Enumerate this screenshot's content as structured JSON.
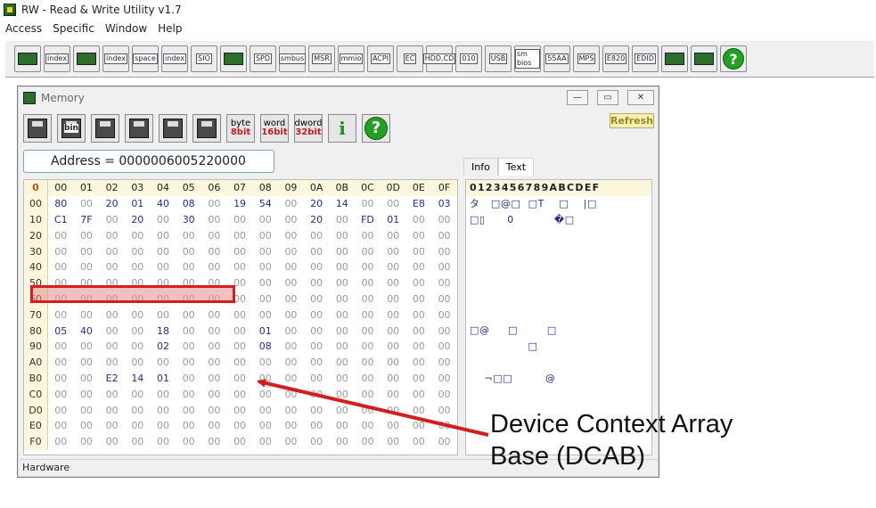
{
  "window_title": "RW - Read & Write Utility v1.7",
  "menu": [
    "Access",
    "Specific",
    "Window",
    "Help"
  ],
  "toolbar": [
    {
      "icon": "pci-chip-icon",
      "label": ""
    },
    {
      "icon": "pci-index-icon",
      "label": "index"
    },
    {
      "icon": "memory-icon",
      "label": ""
    },
    {
      "icon": "memory-index-icon",
      "label": "index"
    },
    {
      "icon": "io-space-icon",
      "label": "space"
    },
    {
      "icon": "io-index-icon",
      "label": "index"
    },
    {
      "icon": "sio-icon",
      "label": "SIO"
    },
    {
      "icon": "oscilloscope-icon",
      "label": ""
    },
    {
      "icon": "spd-icon",
      "label": "SPD"
    },
    {
      "icon": "smbus-icon",
      "label": "smbus"
    },
    {
      "icon": "msr-icon",
      "label": "MSR"
    },
    {
      "icon": "mmio-icon",
      "label": "mmio"
    },
    {
      "icon": "acpi-icon",
      "label": "ACPI"
    },
    {
      "icon": "ec-icon",
      "label": "EC"
    },
    {
      "icon": "hdd-cd-icon",
      "label": "HDD,CD"
    },
    {
      "icon": "binary-icon",
      "label": "010"
    },
    {
      "icon": "usb-icon",
      "label": "USB"
    },
    {
      "icon": "smbios-icon",
      "label": "sm bios"
    },
    {
      "icon": "55aa-icon",
      "label": "55AA"
    },
    {
      "icon": "mps-icon",
      "label": "MPS"
    },
    {
      "icon": "e820-icon",
      "label": "E820"
    },
    {
      "icon": "edid-icon",
      "label": "EDID"
    },
    {
      "icon": "console-icon",
      "label": ""
    },
    {
      "icon": "tools-icon",
      "label": ""
    },
    {
      "icon": "help-icon",
      "label": "?"
    }
  ],
  "mem_window": {
    "title": "Memory",
    "refresh_label": "Refresh",
    "address": "Address = 0000006005220000",
    "tools": [
      {
        "icon": "save-icon",
        "l1": "",
        "l2": ""
      },
      {
        "icon": "save-bin-icon",
        "l1": "bin",
        "l2": ""
      },
      {
        "icon": "open-icon",
        "l1": "",
        "l2": ""
      },
      {
        "icon": "open-compare-icon",
        "l1": "",
        "l2": ""
      },
      {
        "icon": "binoculars-icon",
        "l1": "",
        "l2": ""
      },
      {
        "icon": "window-icon",
        "l1": "",
        "l2": ""
      },
      {
        "icon": "byte-mode-icon",
        "l1": "byte",
        "l2": "8bit"
      },
      {
        "icon": "word-mode-icon",
        "l1": "word",
        "l2": "16bit"
      },
      {
        "icon": "dword-mode-icon",
        "l1": "dword",
        "l2": "32bit"
      },
      {
        "icon": "info-icon",
        "l1": "i",
        "l2": ""
      },
      {
        "icon": "help-icon",
        "l1": "?",
        "l2": ""
      }
    ],
    "tabs": [
      "Info",
      "Text"
    ],
    "status": "Hardware"
  },
  "hex": {
    "corner": "0",
    "columns": [
      "00",
      "01",
      "02",
      "03",
      "04",
      "05",
      "06",
      "07",
      "08",
      "09",
      "0A",
      "0B",
      "0C",
      "0D",
      "0E",
      "0F"
    ],
    "rows": [
      {
        "label": "00",
        "cells": [
          "80",
          "00",
          "20",
          "01",
          "40",
          "08",
          "00",
          "19",
          "54",
          "00",
          "20",
          "14",
          "00",
          "00",
          "E8",
          "03"
        ]
      },
      {
        "label": "10",
        "cells": [
          "C1",
          "7F",
          "00",
          "20",
          "00",
          "30",
          "00",
          "00",
          "00",
          "00",
          "20",
          "00",
          "FD",
          "01",
          "00",
          "00"
        ]
      },
      {
        "label": "20",
        "cells": [
          "00",
          "00",
          "00",
          "00",
          "00",
          "00",
          "00",
          "00",
          "00",
          "00",
          "00",
          "00",
          "00",
          "00",
          "00",
          "00"
        ]
      },
      {
        "label": "30",
        "cells": [
          "00",
          "00",
          "00",
          "00",
          "00",
          "00",
          "00",
          "00",
          "00",
          "00",
          "00",
          "00",
          "00",
          "00",
          "00",
          "00"
        ]
      },
      {
        "label": "40",
        "cells": [
          "00",
          "00",
          "00",
          "00",
          "00",
          "00",
          "00",
          "00",
          "00",
          "00",
          "00",
          "00",
          "00",
          "00",
          "00",
          "00"
        ]
      },
      {
        "label": "50",
        "cells": [
          "00",
          "00",
          "00",
          "00",
          "00",
          "00",
          "00",
          "00",
          "00",
          "00",
          "00",
          "00",
          "00",
          "00",
          "00",
          "00"
        ]
      },
      {
        "label": "60",
        "cells": [
          "00",
          "00",
          "00",
          "00",
          "00",
          "00",
          "00",
          "00",
          "00",
          "00",
          "00",
          "00",
          "00",
          "00",
          "00",
          "00"
        ]
      },
      {
        "label": "70",
        "cells": [
          "00",
          "00",
          "00",
          "00",
          "00",
          "00",
          "00",
          "00",
          "00",
          "00",
          "00",
          "00",
          "00",
          "00",
          "00",
          "00"
        ]
      },
      {
        "label": "80",
        "cells": [
          "05",
          "40",
          "00",
          "00",
          "18",
          "00",
          "00",
          "00",
          "01",
          "00",
          "00",
          "00",
          "00",
          "00",
          "00",
          "00"
        ]
      },
      {
        "label": "90",
        "cells": [
          "00",
          "00",
          "00",
          "00",
          "02",
          "00",
          "00",
          "00",
          "08",
          "00",
          "00",
          "00",
          "00",
          "00",
          "00",
          "00"
        ]
      },
      {
        "label": "A0",
        "cells": [
          "00",
          "00",
          "00",
          "00",
          "00",
          "00",
          "00",
          "00",
          "00",
          "00",
          "00",
          "00",
          "00",
          "00",
          "00",
          "00"
        ]
      },
      {
        "label": "B0",
        "cells": [
          "00",
          "00",
          "E2",
          "14",
          "01",
          "00",
          "00",
          "00",
          "00",
          "00",
          "00",
          "00",
          "00",
          "00",
          "00",
          "00"
        ]
      },
      {
        "label": "C0",
        "cells": [
          "00",
          "00",
          "00",
          "00",
          "00",
          "00",
          "00",
          "00",
          "00",
          "00",
          "00",
          "00",
          "00",
          "00",
          "00",
          "00"
        ]
      },
      {
        "label": "D0",
        "cells": [
          "00",
          "00",
          "00",
          "00",
          "00",
          "00",
          "00",
          "00",
          "00",
          "00",
          "00",
          "00",
          "00",
          "00",
          "00",
          "00"
        ]
      },
      {
        "label": "E0",
        "cells": [
          "00",
          "00",
          "00",
          "00",
          "00",
          "00",
          "00",
          "00",
          "00",
          "00",
          "00",
          "00",
          "00",
          "00",
          "00",
          "00"
        ]
      },
      {
        "label": "F0",
        "cells": [
          "00",
          "00",
          "00",
          "00",
          "00",
          "00",
          "00",
          "00",
          "00",
          "00",
          "00",
          "00",
          "00",
          "00",
          "00",
          "00"
        ]
      }
    ]
  },
  "text_panel": {
    "header": "0123456789ABCDEF",
    "rows": [
      "タ   □@□  □T    □    |□",
      "□▯      0           �□",
      "",
      "",
      "",
      "",
      "",
      "",
      "□@     □        □",
      "                □",
      "",
      "    ¬□□         @",
      "",
      "",
      "",
      ""
    ]
  },
  "annotation": {
    "line1": "Device Context Array",
    "line2": "Base (DCAB)",
    "color": "#d21e1e"
  }
}
